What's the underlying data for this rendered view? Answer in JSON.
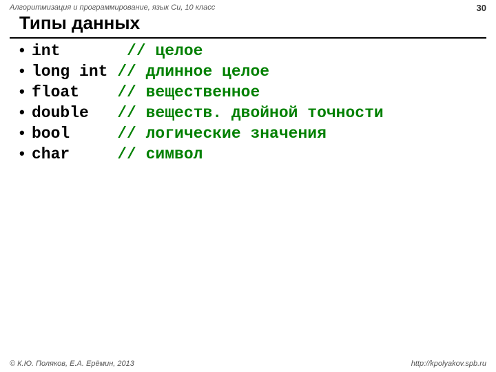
{
  "header": {
    "course": "Алгоритмизация и программирование, язык Си, 10 класс",
    "page": "30"
  },
  "title": "Типы данных",
  "rows": [
    {
      "type": "int     ",
      "comment": "  // целое"
    },
    {
      "type": "long int",
      "comment": " // длинное целое"
    },
    {
      "type": "float   ",
      "comment": " // вещественное"
    },
    {
      "type": "double  ",
      "comment": " // веществ. двойной точности"
    },
    {
      "type": "bool    ",
      "comment": " // логические значения"
    },
    {
      "type": "char    ",
      "comment": " // символ"
    }
  ],
  "footer": {
    "copyright": "© К.Ю. Поляков, Е.А. Ерёмин, 2013",
    "url": "http://kpolyakov.spb.ru"
  }
}
